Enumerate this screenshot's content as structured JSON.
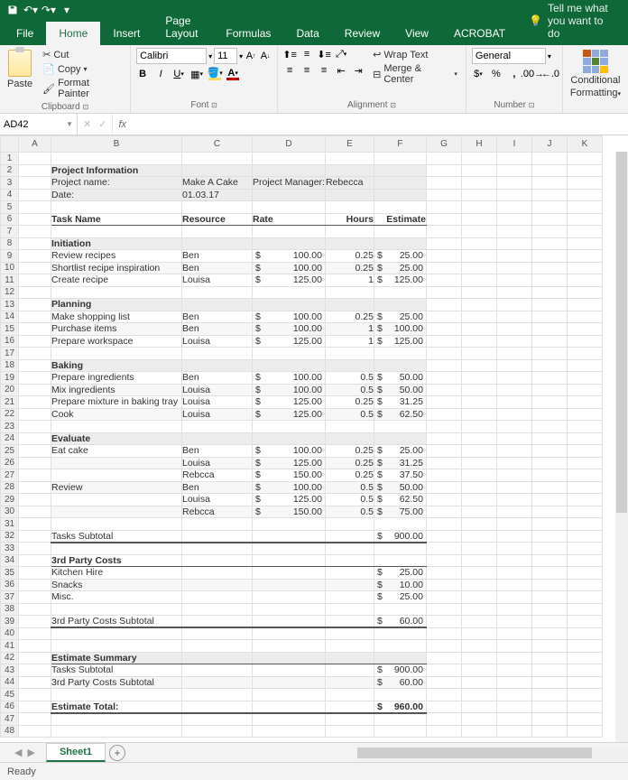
{
  "titlebar": {},
  "tabs": {
    "file": "File",
    "home": "Home",
    "insert": "Insert",
    "page_layout": "Page Layout",
    "formulas": "Formulas",
    "data": "Data",
    "review": "Review",
    "view": "View",
    "acrobat": "ACROBAT",
    "tell_me": "Tell me what you want to do"
  },
  "ribbon": {
    "clipboard": {
      "paste": "Paste",
      "cut": "Cut",
      "copy": "Copy",
      "format_painter": "Format Painter",
      "label": "Clipboard"
    },
    "font": {
      "name": "Calibri",
      "size": "11",
      "label": "Font"
    },
    "alignment": {
      "wrap": "Wrap Text",
      "merge": "Merge & Center",
      "label": "Alignment"
    },
    "number": {
      "format": "General",
      "label": "Number"
    },
    "styles": {
      "cond": "Conditional",
      "cond2": "Formatting"
    }
  },
  "namebox": {
    "ref": "AD42",
    "fx": "fx"
  },
  "sheet_tabs": {
    "sheet1": "Sheet1"
  },
  "statusbar": {
    "ready": "Ready"
  },
  "chart_data": {
    "type": "table",
    "title": "Project Information",
    "project": {
      "name_label": "Project name:",
      "name": "Make A Cake",
      "pm_label": "Project Manager:",
      "pm": "Rebecca",
      "date_label": "Date:",
      "date": "01.03.17"
    },
    "columns": [
      "Task Name",
      "Resource",
      "Rate",
      "Hours",
      "Estimate"
    ],
    "sections": [
      {
        "name": "Initiation",
        "rows": [
          {
            "task": "Review recipes",
            "resource": "Ben",
            "rate": 100.0,
            "hours": 0.25,
            "estimate": 25.0
          },
          {
            "task": "Shortlist recipe inspiration",
            "resource": "Ben",
            "rate": 100.0,
            "hours": 0.25,
            "estimate": 25.0
          },
          {
            "task": "Create recipe",
            "resource": "Louisa",
            "rate": 125.0,
            "hours": 1,
            "estimate": 125.0
          }
        ]
      },
      {
        "name": "Planning",
        "rows": [
          {
            "task": "Make shopping list",
            "resource": "Ben",
            "rate": 100.0,
            "hours": 0.25,
            "estimate": 25.0
          },
          {
            "task": "Purchase items",
            "resource": "Ben",
            "rate": 100.0,
            "hours": 1,
            "estimate": 100.0
          },
          {
            "task": "Prepare workspace",
            "resource": "Louisa",
            "rate": 125.0,
            "hours": 1,
            "estimate": 125.0
          }
        ]
      },
      {
        "name": "Baking",
        "rows": [
          {
            "task": "Prepare ingredients",
            "resource": "Ben",
            "rate": 100.0,
            "hours": 0.5,
            "estimate": 50.0
          },
          {
            "task": "Mix ingredients",
            "resource": "Louisa",
            "rate": 100.0,
            "hours": 0.5,
            "estimate": 50.0
          },
          {
            "task": "Prepare mixture in baking tray",
            "resource": "Louisa",
            "rate": 125.0,
            "hours": 0.25,
            "estimate": 31.25
          },
          {
            "task": "Cook",
            "resource": "Louisa",
            "rate": 125.0,
            "hours": 0.5,
            "estimate": 62.5
          }
        ]
      },
      {
        "name": "Evaluate",
        "rows": [
          {
            "task": "Eat cake",
            "resource": "Ben",
            "rate": 100.0,
            "hours": 0.25,
            "estimate": 25.0
          },
          {
            "task": "",
            "resource": "Louisa",
            "rate": 125.0,
            "hours": 0.25,
            "estimate": 31.25
          },
          {
            "task": "",
            "resource": "Rebcca",
            "rate": 150.0,
            "hours": 0.25,
            "estimate": 37.5
          },
          {
            "task": "Review",
            "resource": "Ben",
            "rate": 100.0,
            "hours": 0.5,
            "estimate": 50.0
          },
          {
            "task": "",
            "resource": "Louisa",
            "rate": 125.0,
            "hours": 0.5,
            "estimate": 62.5
          },
          {
            "task": "",
            "resource": "Rebcca",
            "rate": 150.0,
            "hours": 0.5,
            "estimate": 75.0
          }
        ]
      }
    ],
    "tasks_subtotal_label": "Tasks Subtotal",
    "tasks_subtotal": 900.0,
    "third_party_header": "3rd Party Costs",
    "third_party": [
      {
        "name": "Kitchen Hire",
        "cost": 25.0
      },
      {
        "name": "Snacks",
        "cost": 10.0
      },
      {
        "name": "Misc.",
        "cost": 25.0
      }
    ],
    "third_party_subtotal_label": "3rd Party Costs Subtotal",
    "third_party_subtotal": 60.0,
    "summary_header": "Estimate Summary",
    "summary": {
      "tasks_label": "Tasks Subtotal",
      "tasks": 900.0,
      "third_label": "3rd Party Costs Subtotal",
      "third": 60.0,
      "total_label": "Estimate Total:",
      "total": 960.0
    }
  }
}
